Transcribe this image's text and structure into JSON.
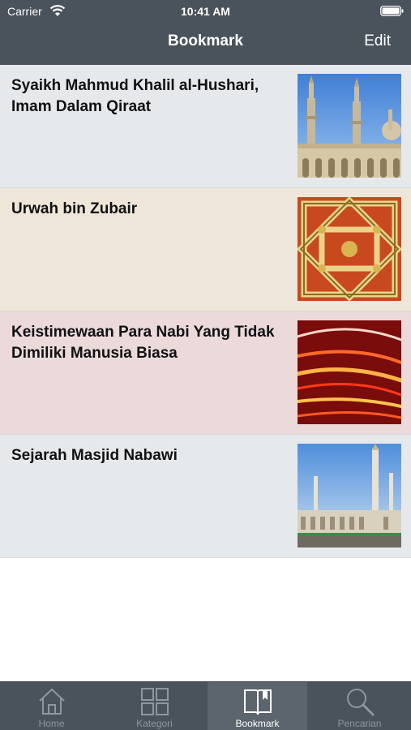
{
  "status_bar": {
    "carrier": "Carrier",
    "time": "10:41 AM"
  },
  "nav": {
    "title": "Bookmark",
    "edit_label": "Edit"
  },
  "bookmarks": [
    {
      "title": "Syaikh Mahmud Khalil al-Hushari, Imam Dalam Qiraat",
      "background": "#e6e9ec",
      "thumbnail": "mosque-minarets-photo"
    },
    {
      "title": "Urwah bin Zubair",
      "background": "#efe6da",
      "thumbnail": "ornament-pattern-photo"
    },
    {
      "title": "Keistimewaan Para Nabi Yang Tidak Dimiliki Manusia Biasa",
      "background": "#ecdada",
      "thumbnail": "light-streaks-photo"
    },
    {
      "title": "Sejarah Masjid Nabawi",
      "background": "#e6e9ec",
      "thumbnail": "masjid-nabawi-photo"
    }
  ],
  "tabs": [
    {
      "label": "Home",
      "icon": "home-icon",
      "active": false
    },
    {
      "label": "Kategori",
      "icon": "grid-icon",
      "active": false
    },
    {
      "label": "Bookmark",
      "icon": "book-icon",
      "active": true
    },
    {
      "label": "Pencarian",
      "icon": "search-icon",
      "active": false
    }
  ]
}
